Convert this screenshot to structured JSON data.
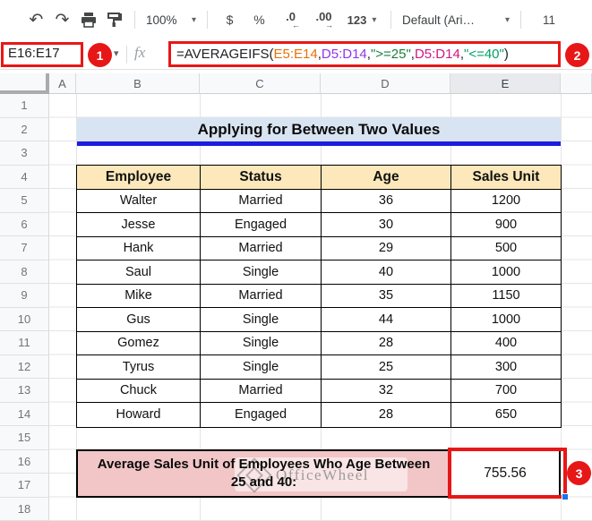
{
  "toolbar": {
    "zoom_level": "100%",
    "currency_label": "$",
    "percent_label": "%",
    "decrease_decimal": ".0",
    "decrease_decimal_arrow": "←",
    "increase_decimal": ".00",
    "increase_decimal_arrow": "→",
    "more_formats_label": "123",
    "font_name": "Default (Ari…",
    "font_size": "11",
    "icons": {
      "undo": "↶",
      "redo": "↷",
      "dropdown": "▾"
    }
  },
  "formula_bar": {
    "name_box": "E16:E17",
    "fx_label": "fx",
    "formula_parts": [
      {
        "text": "=AVERAGEIFS(",
        "color": "formula_black"
      },
      {
        "text": "E5:E14",
        "color": "formula_orange"
      },
      {
        "text": ",",
        "color": "formula_black"
      },
      {
        "text": "D5:D14",
        "color": "formula_purple"
      },
      {
        "text": ",",
        "color": "formula_black"
      },
      {
        "text": "\">=25\"",
        "color": "formula_green"
      },
      {
        "text": ",",
        "color": "formula_black"
      },
      {
        "text": "D5:D14",
        "color": "formula_magenta"
      },
      {
        "text": ",",
        "color": "formula_black"
      },
      {
        "text": "\"<=40\"",
        "color": "formula_teal"
      },
      {
        "text": ")",
        "color": "formula_black"
      }
    ]
  },
  "annotations": {
    "step1": "1",
    "step2": "2",
    "step3": "3"
  },
  "grid": {
    "column_headers": [
      "A",
      "B",
      "C",
      "D",
      "E"
    ],
    "selected_column": "E",
    "row_headers": [
      "1",
      "2",
      "3",
      "4",
      "5",
      "6",
      "7",
      "8",
      "9",
      "10",
      "11",
      "12",
      "13",
      "14",
      "15",
      "16",
      "17",
      "18"
    ]
  },
  "sheet": {
    "title": "Applying for Between Two Values",
    "table": {
      "headers": [
        "Employee",
        "Status",
        "Age",
        "Sales Unit"
      ],
      "rows": [
        [
          "Walter",
          "Married",
          "36",
          "1200"
        ],
        [
          "Jesse",
          "Engaged",
          "30",
          "900"
        ],
        [
          "Hank",
          "Married",
          "29",
          "500"
        ],
        [
          "Saul",
          "Single",
          "40",
          "1000"
        ],
        [
          "Mike",
          "Married",
          "35",
          "1150"
        ],
        [
          "Gus",
          "Single",
          "44",
          "1000"
        ],
        [
          "Gomez",
          "Single",
          "28",
          "400"
        ],
        [
          "Tyrus",
          "Single",
          "25",
          "300"
        ],
        [
          "Chuck",
          "Married",
          "32",
          "700"
        ],
        [
          "Howard",
          "Engaged",
          "28",
          "650"
        ]
      ]
    },
    "summary": {
      "label": "Average Sales Unit of Employees Who Age Between 25 and 40:",
      "value": "755.56"
    },
    "watermark": {
      "text": "OfficeWheel"
    }
  },
  "colors": {
    "annotation_red": "#e81717",
    "title_bg": "#d9e4f2",
    "title_underline": "#1d1de0",
    "table_header_bg": "#fce8ba",
    "summary_bg": "#f2c6c6",
    "selection_handle": "#1a73e8",
    "formula_black": "#202124",
    "formula_orange": "#e8710a",
    "formula_purple": "#9334e6",
    "formula_green": "#188038",
    "formula_magenta": "#d01884",
    "formula_teal": "#00a167"
  }
}
